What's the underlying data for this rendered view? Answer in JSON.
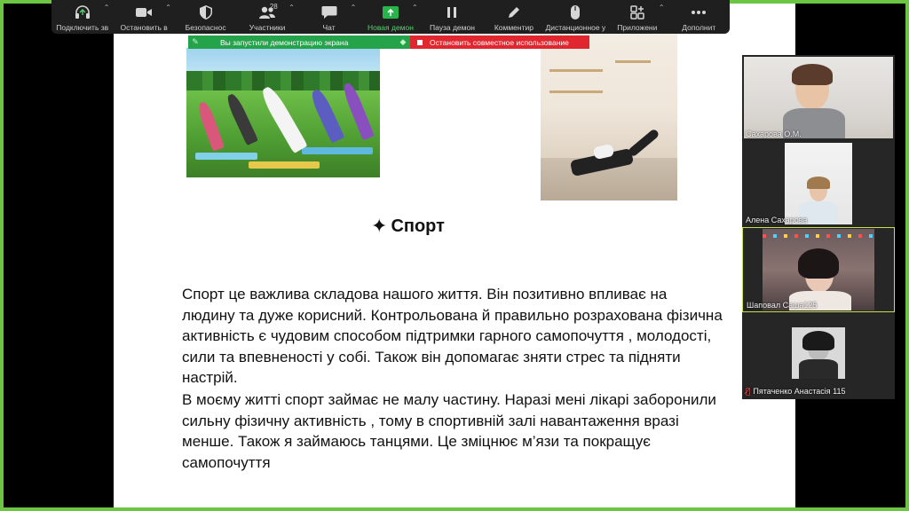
{
  "toolbar": {
    "items": [
      {
        "label": "Подключить зв",
        "icon": "headphones-icon",
        "caret": true
      },
      {
        "label": "Остановить в",
        "icon": "video-camera-icon",
        "caret": true
      },
      {
        "label": "Безопаснос",
        "icon": "shield-icon",
        "caret": false
      },
      {
        "label": "Участники",
        "icon": "participants-icon",
        "badge": "28",
        "caret": true
      },
      {
        "label": "Чат",
        "icon": "chat-icon",
        "caret": true
      },
      {
        "label": "Новая демон",
        "icon": "share-screen-icon",
        "caret": true,
        "active": true
      },
      {
        "label": "Пауза демон",
        "icon": "pause-icon",
        "caret": false
      },
      {
        "label": "Комментир",
        "icon": "pen-icon",
        "caret": false
      },
      {
        "label": "Дистанционное у",
        "icon": "mouse-icon",
        "caret": false
      },
      {
        "label": "Приложени",
        "icon": "apps-icon",
        "caret": true
      },
      {
        "label": "Дополнит",
        "icon": "more-icon",
        "caret": false
      }
    ]
  },
  "banner": {
    "sharing_text": "Вы запустили демонстрацию экрана",
    "stop_text": "Остановить совместное использование",
    "sharing_color": "#24a34a",
    "stop_color": "#e0262e"
  },
  "slide": {
    "title": "Спорт",
    "title_icon": "sparkles-icon",
    "paragraph1": "Спорт це важлива складова нашого життя. Він позитивно впливає на людину  та дуже корисний. Контрольована й правильно розрахована  фізична активність є чудовим способом підтримки гарного самопочуття , молодості, сили та впевненості у собі. Також він допомагає зняти стрес та підняти настрій.",
    "paragraph2": "В моєму житті спорт займає не малу частину.  Наразі мені лікарі заборонили сильну фізичну активність , тому в спортивній залі навантаження вразі менше. Також я займаюсь танцями.  Це зміцнює м’язи  та покращує самопочуття"
  },
  "participants": [
    {
      "name": "Сахарова О.М.",
      "muted": false,
      "speaking": false
    },
    {
      "name": "Алена Сахарова",
      "muted": false,
      "speaking": false
    },
    {
      "name": "Шаповал Саша125",
      "muted": false,
      "speaking": true
    },
    {
      "name": "Пятаченко Анастасія 115",
      "muted": true,
      "speaking": false
    }
  ],
  "colors": {
    "share_border": "#6cc644",
    "speaking_border": "#c9e04a"
  }
}
